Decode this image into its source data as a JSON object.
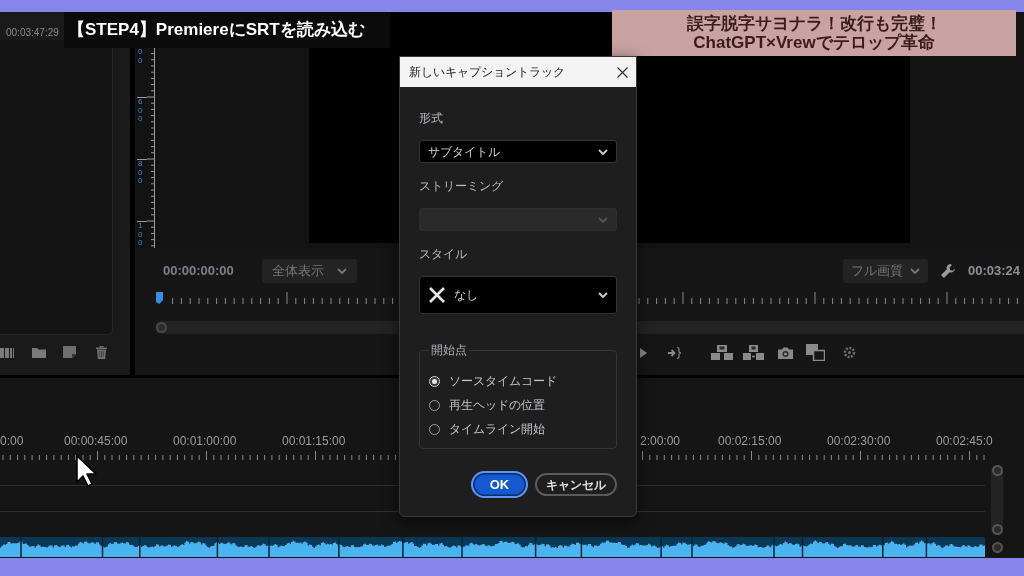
{
  "title_banner": {
    "text": "【STEP4】PremiereにSRTを読み込む"
  },
  "headline_banner": {
    "lines": [
      "誤字脱字サヨナラ！改行も完璧！",
      "ChatGPT×Vrewでテロップ革命"
    ]
  },
  "project_panel": {
    "timecode": "00:03:47:29"
  },
  "program_monitor": {
    "ruler_labels": [
      "00",
      "600",
      "800",
      "100"
    ],
    "timecode": "00:00:00:00",
    "zoom_dropdown": "全体表示",
    "quality_dropdown": "フル画質",
    "duration": "00:03:24"
  },
  "timeline": {
    "timecodes": [
      "0:00",
      "00:00:45:00",
      "00:01:00:00",
      "00:01:15:00",
      "2:00:00",
      "00:02:15:00",
      "00:02:30:00",
      "00:02:45:0"
    ]
  },
  "dialog": {
    "title": "新しいキャプショントラック",
    "fields": [
      {
        "kind": "select",
        "label": "形式",
        "value": "サブタイトル",
        "disabled": false
      },
      {
        "kind": "select",
        "label": "ストリーミング",
        "disabled": true
      },
      {
        "kind": "style-select",
        "label": "スタイル",
        "value": "なし",
        "disabled": false
      }
    ],
    "start_point": {
      "legend": "開始点",
      "options": [
        {
          "label": "ソースタイムコード",
          "selected": true
        },
        {
          "label": "再生ヘッドの位置",
          "selected": false
        },
        {
          "label": "タイムライン開始",
          "selected": false
        }
      ]
    },
    "buttons": [
      {
        "kind": "primary",
        "label": "OK"
      },
      {
        "kind": "secondary",
        "label": "キャンセル"
      }
    ]
  }
}
